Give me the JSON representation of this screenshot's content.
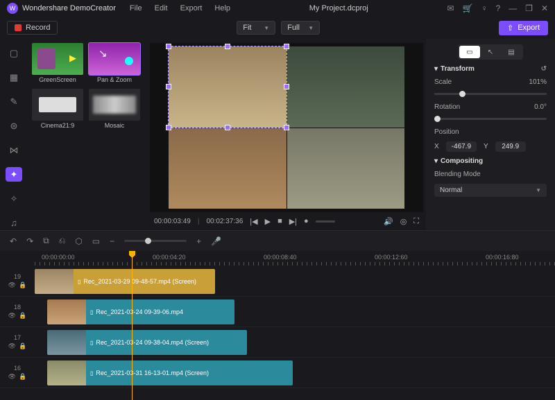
{
  "app": {
    "name": "Wondershare DemoCreator",
    "project_title": "My Project.dcproj"
  },
  "menus": {
    "file": "File",
    "edit": "Edit",
    "export": "Export",
    "help": "Help"
  },
  "titlebar_icons": {
    "message": "✉",
    "cart": "🛒",
    "account": "♀",
    "help": "?",
    "minimize": "—",
    "maximize": "❐",
    "close": "✕"
  },
  "toolbar": {
    "record": "Record",
    "fit_select": "Fit",
    "playback_select": "Full",
    "export_btn": "Export"
  },
  "rail_icons": [
    "folder-icon",
    "template-icon",
    "annotation-icon",
    "caption-icon",
    "cursor-icon",
    "transition-icon",
    "effects-icon",
    "pin-icon",
    "audio-icon"
  ],
  "browser": {
    "items": [
      {
        "name": "greenscreen",
        "label": "GreenScreen"
      },
      {
        "name": "pan-zoom",
        "label": "Pan & Zoom"
      },
      {
        "name": "cinema219",
        "label": "Cinema21:9"
      },
      {
        "name": "mosaic",
        "label": "Mosaic"
      }
    ]
  },
  "playbar": {
    "position": "00:00:03:49",
    "duration": "00:02:37:36"
  },
  "properties": {
    "section_transform": "Transform",
    "scale_label": "Scale",
    "scale_value": "101%",
    "rotation_label": "Rotation",
    "rotation_value": "0.0°",
    "position_label": "Position",
    "pos_x_label": "X",
    "pos_x": "-467.9",
    "pos_y_label": "Y",
    "pos_y": "249.9",
    "section_compositing": "Compositing",
    "blending_label": "Blending Mode",
    "blending_value": "Normal"
  },
  "timeline": {
    "ruler": [
      "00:00:00:00",
      "00:00:04:20",
      "00:00:08:40",
      "00:00:12:60",
      "00:00:16:80"
    ],
    "tracks": [
      {
        "num": "19",
        "clip": "Rec_2021-03-29 09-48-57.mp4 (Screen)"
      },
      {
        "num": "18",
        "clip": "Rec_2021-03-24 09-39-06.mp4"
      },
      {
        "num": "17",
        "clip": "Rec_2021-03-24 09-38-04.mp4 (Screen)"
      },
      {
        "num": "16",
        "clip": "Rec_2021-03-31 16-13-01.mp4 (Screen)"
      }
    ]
  }
}
